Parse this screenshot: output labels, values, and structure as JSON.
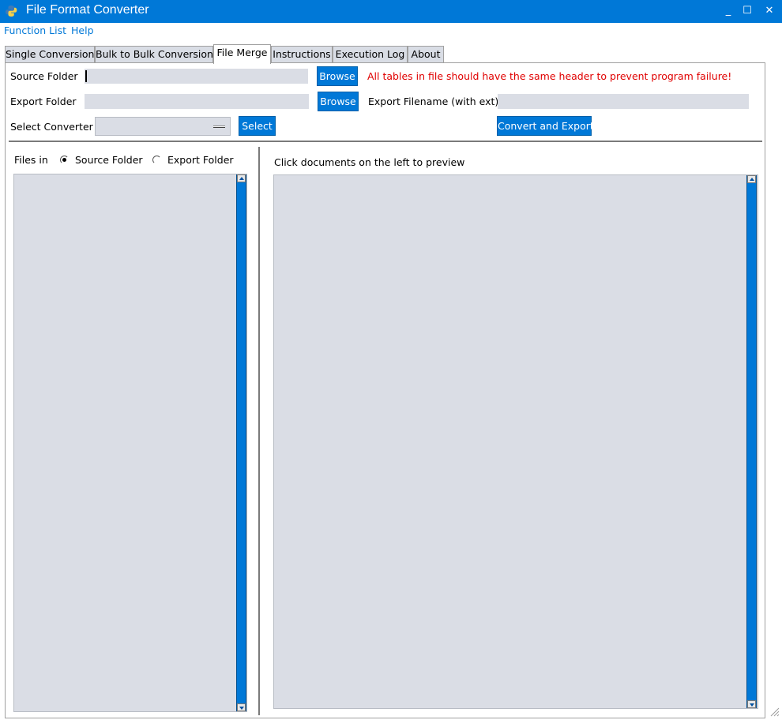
{
  "window": {
    "title": "File Format Converter",
    "minimize_glyph": "_",
    "maximize_glyph": "☐",
    "close_glyph": "✕",
    "accent_color": "#0078d7"
  },
  "menu": {
    "items": [
      {
        "label": "Function List"
      },
      {
        "label": "Help"
      }
    ]
  },
  "tabs": [
    {
      "label": "Single Conversion",
      "active": false
    },
    {
      "label": "Bulk to Bulk Conversion",
      "active": false
    },
    {
      "label": "File Merge",
      "active": true
    },
    {
      "label": "Instructions",
      "active": false
    },
    {
      "label": "Execution Log",
      "active": false
    },
    {
      "label": "About",
      "active": false
    }
  ],
  "form": {
    "source_folder_label": "Source Folder",
    "source_folder_value": "",
    "export_folder_label": "Export Folder",
    "export_folder_value": "",
    "browse_label": "Browse",
    "warning_text": "All tables in file should have the same header to prevent program failure!",
    "warning_color": "#e00000",
    "export_filename_label": "Export Filename (with ext)",
    "export_filename_value": "",
    "select_converter_label": "Select Converter",
    "select_converter_value": "",
    "select_button_label": "Select",
    "convert_button_label": "Convert and Export"
  },
  "files_panel": {
    "files_in_label": "Files in",
    "radio_source_label": "Source Folder",
    "radio_export_label": "Export Folder",
    "selected": "source"
  },
  "preview_panel": {
    "hint_text": "Click documents on the left to preview"
  }
}
